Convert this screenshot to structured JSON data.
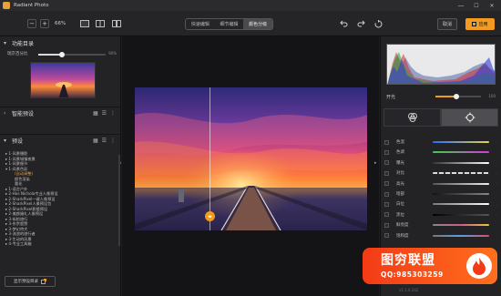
{
  "window": {
    "title": "Radiant Photo",
    "min": "—",
    "max": "☐",
    "close": "✕"
  },
  "toolbar": {
    "zoom_out": "−",
    "zoom_in": "+",
    "zoom_value": "66%",
    "modes": [
      "快速编辑",
      "细节编辑",
      "颜色分级"
    ],
    "active_mode": 2,
    "cancel_label": "取消",
    "apply_label": "应用"
  },
  "left_panel": {
    "features_title": "功能目录",
    "strength_label": "瑞京百分比",
    "strength_value": "90%",
    "strength_level": 0.35,
    "smart_presets_title": "智能预设",
    "presets_title": "预设",
    "preset_tree": [
      {
        "text": "▸ 1-风景摄影",
        "level": 0,
        "selected": false
      },
      {
        "text": "▸ 1-风景城镇夜景",
        "level": 0,
        "selected": false
      },
      {
        "text": "▸ 1-风景细节",
        "level": 0,
        "selected": false
      },
      {
        "text": "▾ 1-风景色彩",
        "level": 0,
        "selected": false
      },
      {
        "text": "(自动调整)",
        "level": 1,
        "selected": true
      },
      {
        "text": "颜色渲染",
        "level": 1,
        "selected": false
      },
      {
        "text": "量化",
        "level": 1,
        "selected": false
      },
      {
        "text": "▸ 1-语言户外",
        "level": 0,
        "selected": false
      },
      {
        "text": "▸ 2-Hos Nichola专业人像预设",
        "level": 0,
        "selected": false
      },
      {
        "text": "▸ 2-SharkPixel一键人像预设",
        "level": 0,
        "selected": false
      },
      {
        "text": "▸ 2-SharkPixel人像预设包",
        "level": 0,
        "selected": false
      },
      {
        "text": "▸ 2-SharkPixel影楼预设",
        "level": 0,
        "selected": false
      },
      {
        "text": "▸ 2-美颜婚礼人像预设",
        "level": 0,
        "selected": false
      },
      {
        "text": "▸ 3-街拍旅行",
        "level": 0,
        "selected": false
      },
      {
        "text": "▸ 3-东京超赞",
        "level": 0,
        "selected": false
      },
      {
        "text": "▸ 3-梦幻特大",
        "level": 0,
        "selected": false
      },
      {
        "text": "▸ 3-流浪的旅行者",
        "level": 0,
        "selected": false
      },
      {
        "text": "▸ 3-生动的风景",
        "level": 0,
        "selected": false
      },
      {
        "text": "▸ 4-专业工具箱",
        "level": 0,
        "selected": false
      }
    ],
    "open_folder_label": "显示预设目录"
  },
  "right_panel": {
    "contrast_label": "开光",
    "contrast_value": "100",
    "contrast_level": 0.45,
    "adjustments": [
      {
        "label": "色温",
        "bar": "linear-gradient(90deg,#2a6cff,#e6d24a)"
      },
      {
        "label": "色调",
        "bar": "linear-gradient(90deg,#3ad14a,#d63ad6)"
      },
      {
        "label": "曝光",
        "bar": "linear-gradient(90deg,#333,#fff)"
      },
      {
        "label": "对比",
        "bar": "repeating-linear-gradient(90deg,#ddd 0 5px,#333 5px 7px)"
      },
      {
        "label": "高光",
        "bar": "linear-gradient(90deg,#555,#eee)"
      },
      {
        "label": "暗部",
        "bar": "linear-gradient(90deg,#111,#888)"
      },
      {
        "label": "白位",
        "bar": "linear-gradient(90deg,#777,#fff)"
      },
      {
        "label": "黑位",
        "bar": "linear-gradient(90deg,#000,#555)"
      },
      {
        "label": "鲜亮度",
        "bar": "linear-gradient(90deg,#888,#d05a8a,#e6c640)"
      },
      {
        "label": "饱和度",
        "bar": "linear-gradient(90deg,#777,#5aa0e0,#e04a6a)"
      }
    ],
    "version": "v1.1.0.242"
  },
  "watermark": {
    "title": "图穷联盟",
    "qq": "QQ:985303259"
  },
  "colors": {
    "accent": "#f39b1e",
    "panel": "#232326",
    "canvas": "#141416"
  }
}
